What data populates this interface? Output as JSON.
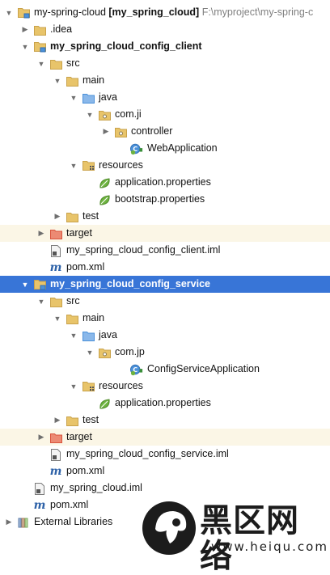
{
  "project_tree": {
    "rows": [
      {
        "name": "tree-node-my-spring-cloud",
        "label": "my-spring-cloud",
        "bold_suffix": " [my_spring_cloud]",
        "hint": "F:\\myproject\\my-spring-c",
        "icon": "module-folder-icon",
        "arrow": "expanded",
        "depth": 0
      },
      {
        "name": "tree-node-idea",
        "label": ".idea",
        "icon": "folder-icon",
        "arrow": "collapsed",
        "depth": 1
      },
      {
        "name": "tree-node-config-client",
        "label": "my_spring_cloud_config_client",
        "bold": true,
        "icon": "module-folder-icon",
        "arrow": "expanded",
        "depth": 1
      },
      {
        "name": "tree-node-client-src",
        "label": "src",
        "icon": "folder-icon",
        "arrow": "expanded",
        "depth": 2
      },
      {
        "name": "tree-node-client-main",
        "label": "main",
        "icon": "folder-icon",
        "arrow": "expanded",
        "depth": 3
      },
      {
        "name": "tree-node-client-java",
        "label": "java",
        "icon": "source-folder-icon",
        "arrow": "expanded",
        "depth": 4
      },
      {
        "name": "tree-node-client-package",
        "label": "com.ji",
        "icon": "package-icon",
        "arrow": "expanded",
        "depth": 5
      },
      {
        "name": "tree-node-client-controller",
        "label": "controller",
        "icon": "package-icon",
        "arrow": "collapsed",
        "depth": 6
      },
      {
        "name": "tree-node-client-webapplication",
        "label": "WebApplication",
        "icon": "spring-boot-class-icon",
        "arrow": "none",
        "depth": 7
      },
      {
        "name": "tree-node-client-resources",
        "label": "resources",
        "icon": "resources-folder-icon",
        "arrow": "expanded",
        "depth": 4
      },
      {
        "name": "tree-node-client-application-properties",
        "label": "application.properties",
        "icon": "spring-leaf-icon",
        "arrow": "none",
        "depth": 5
      },
      {
        "name": "tree-node-client-bootstrap-properties",
        "label": "bootstrap.properties",
        "icon": "spring-leaf-icon",
        "arrow": "none",
        "depth": 5
      },
      {
        "name": "tree-node-client-test",
        "label": "test",
        "icon": "folder-icon",
        "arrow": "collapsed",
        "depth": 3
      },
      {
        "name": "tree-node-client-target",
        "label": "target",
        "icon": "excluded-folder-icon",
        "arrow": "collapsed",
        "depth": 2,
        "excluded": true
      },
      {
        "name": "tree-node-client-iml",
        "label": "my_spring_cloud_config_client.iml",
        "icon": "iml-file-icon",
        "arrow": "none",
        "depth": 2
      },
      {
        "name": "tree-node-client-pom",
        "label": "pom.xml",
        "icon": "maven-icon",
        "arrow": "none",
        "depth": 2
      },
      {
        "name": "tree-node-config-service",
        "label": "my_spring_cloud_config_service",
        "bold": true,
        "icon": "module-folder-icon",
        "arrow": "expanded",
        "depth": 1,
        "selected": true
      },
      {
        "name": "tree-node-service-src",
        "label": "src",
        "icon": "folder-icon",
        "arrow": "expanded",
        "depth": 2
      },
      {
        "name": "tree-node-service-main",
        "label": "main",
        "icon": "folder-icon",
        "arrow": "expanded",
        "depth": 3
      },
      {
        "name": "tree-node-service-java",
        "label": "java",
        "icon": "source-folder-icon",
        "arrow": "expanded",
        "depth": 4
      },
      {
        "name": "tree-node-service-package",
        "label": "com.jp",
        "icon": "package-icon",
        "arrow": "expanded",
        "depth": 5
      },
      {
        "name": "tree-node-service-configserviceapplication",
        "label": "ConfigServiceApplication",
        "icon": "spring-boot-class-icon",
        "arrow": "none",
        "depth": 7
      },
      {
        "name": "tree-node-service-resources",
        "label": "resources",
        "icon": "resources-folder-icon",
        "arrow": "expanded",
        "depth": 4
      },
      {
        "name": "tree-node-service-application-properties",
        "label": "application.properties",
        "icon": "spring-leaf-icon",
        "arrow": "none",
        "depth": 5
      },
      {
        "name": "tree-node-service-test",
        "label": "test",
        "icon": "folder-icon",
        "arrow": "collapsed",
        "depth": 3
      },
      {
        "name": "tree-node-service-target",
        "label": "target",
        "icon": "excluded-folder-icon",
        "arrow": "collapsed",
        "depth": 2,
        "excluded": true
      },
      {
        "name": "tree-node-service-iml",
        "label": "my_spring_cloud_config_service.iml",
        "icon": "iml-file-icon",
        "arrow": "none",
        "depth": 2
      },
      {
        "name": "tree-node-service-pom",
        "label": "pom.xml",
        "icon": "maven-icon",
        "arrow": "none",
        "depth": 2
      },
      {
        "name": "tree-node-root-iml",
        "label": "my_spring_cloud.iml",
        "icon": "iml-file-icon",
        "arrow": "none",
        "depth": 1
      },
      {
        "name": "tree-node-root-pom",
        "label": "pom.xml",
        "icon": "maven-icon",
        "arrow": "none",
        "depth": 1
      },
      {
        "name": "tree-node-external-libraries",
        "label": "External Libraries",
        "icon": "libraries-icon",
        "arrow": "collapsed",
        "depth": 0
      }
    ]
  },
  "watermark": {
    "title": "黑区网络",
    "url": "www.heiqu.com"
  },
  "colors": {
    "selection": "#3875d7",
    "excluded_row": "#fbf6e6",
    "folder": "#e8c46a",
    "source_folder": "#4a90d9",
    "excluded_folder": "#d9533b",
    "spring": "#6db33f",
    "maven": "#2e62a8"
  }
}
